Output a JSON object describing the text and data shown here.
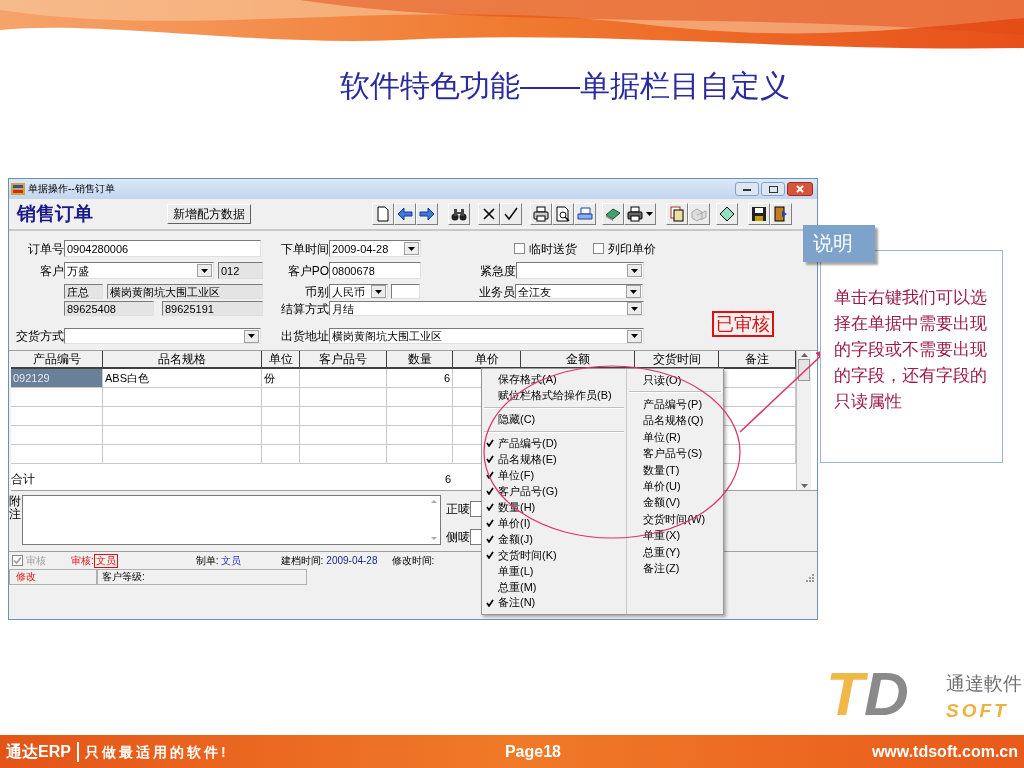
{
  "slide": {
    "title": "软件特色功能——单据栏目自定义"
  },
  "window": {
    "title": "单据操作--销售订单",
    "heading": "销售订单",
    "action_button": "新增配方数据"
  },
  "form": {
    "order_no": {
      "label": "订单号",
      "value": "0904280006"
    },
    "order_date": {
      "label": "下单时间",
      "value": "2009-04-28"
    },
    "options": [
      {
        "label": "临时送货",
        "checked": false
      },
      {
        "label": "列印单价",
        "checked": false
      }
    ],
    "customer": {
      "label": "客户",
      "value": "万盛",
      "code": "012"
    },
    "customer_po": {
      "label": "客户PO",
      "value": "0800678"
    },
    "urgency": {
      "label": "紧急度"
    },
    "customer_info": [
      "庄总",
      "横岗黄阁坑大围工业区",
      "89625408",
      "89625191"
    ],
    "currency": {
      "label": "币别",
      "value": "人民币"
    },
    "salesperson": {
      "label": "业务员",
      "value": "全江友"
    },
    "settlement": {
      "label": "结算方式",
      "value": "月结"
    },
    "delivery_method": {
      "label": "交货方式"
    },
    "ship_address": {
      "label": "出货地址",
      "value": "横岗黄阁坑大围工业区"
    },
    "stamp": "已审核"
  },
  "table": {
    "columns": [
      "产品编号",
      "品名规格",
      "单位",
      "客户品号",
      "数量",
      "单价",
      "金额",
      "交货时间",
      "备注"
    ],
    "rows": [
      {
        "selected": true,
        "cells": [
          "092129",
          "ABS白色",
          "份",
          "",
          "6"
        ]
      }
    ],
    "total": {
      "label": "合计",
      "quantity": "6"
    }
  },
  "remarks": {
    "label": "附注",
    "marks": [
      "正唛",
      "侧唛"
    ]
  },
  "status": {
    "audit_checkbox": {
      "label": "审核",
      "checked": true,
      "disabled": true
    },
    "auditor": {
      "label": "审核:",
      "value": "文员"
    },
    "creator": {
      "label": "制单:",
      "value": "文员"
    },
    "created": {
      "label": "建档时间:",
      "value": "2009-04-28"
    },
    "modified": {
      "label": "修改时间:"
    },
    "mode": "修改",
    "grade_label": "客户等级:"
  },
  "context_menu": {
    "left": [
      {
        "kind": "command",
        "label": "保存格式(A)"
      },
      {
        "kind": "command",
        "label": "赋位栏格式给操作员(B)"
      },
      {
        "kind": "separator"
      },
      {
        "kind": "command",
        "label": "隐藏(C)"
      },
      {
        "kind": "separator"
      },
      {
        "kind": "check",
        "label": "产品编号(D)",
        "checked": true
      },
      {
        "kind": "check",
        "label": "品名规格(E)",
        "checked": true
      },
      {
        "kind": "check",
        "label": "单位(F)",
        "checked": true
      },
      {
        "kind": "check",
        "label": "客户品号(G)",
        "checked": true
      },
      {
        "kind": "check",
        "label": "数量(H)",
        "checked": true
      },
      {
        "kind": "check",
        "label": "单价(I)",
        "checked": true
      },
      {
        "kind": "check",
        "label": "金额(J)",
        "checked": true
      },
      {
        "kind": "check",
        "label": "交货时间(K)",
        "checked": true
      },
      {
        "kind": "check",
        "label": "单重(L)",
        "checked": false
      },
      {
        "kind": "check",
        "label": "总重(M)",
        "checked": false
      },
      {
        "kind": "check",
        "label": "备注(N)",
        "checked": true
      }
    ],
    "right": [
      {
        "kind": "command",
        "label": "只读(O)"
      },
      {
        "kind": "separator"
      },
      {
        "kind": "check",
        "label": "产品编号(P)",
        "checked": false
      },
      {
        "kind": "check",
        "label": "品名规格(Q)",
        "checked": false
      },
      {
        "kind": "check",
        "label": "单位(R)",
        "checked": false
      },
      {
        "kind": "check",
        "label": "客户品号(S)",
        "checked": false
      },
      {
        "kind": "check",
        "label": "数量(T)",
        "checked": false
      },
      {
        "kind": "check",
        "label": "单价(U)",
        "checked": false
      },
      {
        "kind": "check",
        "label": "金额(V)",
        "checked": false
      },
      {
        "kind": "check",
        "label": "交货时间(W)",
        "checked": false
      },
      {
        "kind": "check",
        "label": "单重(X)",
        "checked": false
      },
      {
        "kind": "check",
        "label": "总重(Y)",
        "checked": false
      },
      {
        "kind": "check",
        "label": "备注(Z)",
        "checked": false
      }
    ]
  },
  "callout": {
    "tab": "说明",
    "text": "单击右键我们可以选择在单据中需要出现的字段或不需要出现的字段，还有字段的只读属性"
  },
  "logo": {
    "t": "T",
    "d": "D",
    "name": "通達軟件",
    "soft": "SOFT"
  },
  "footer": {
    "brand": "通达ERP",
    "slogan": "只做最适用的软件!",
    "page": "Page18",
    "url": "www.tdsoft.com.cn"
  }
}
